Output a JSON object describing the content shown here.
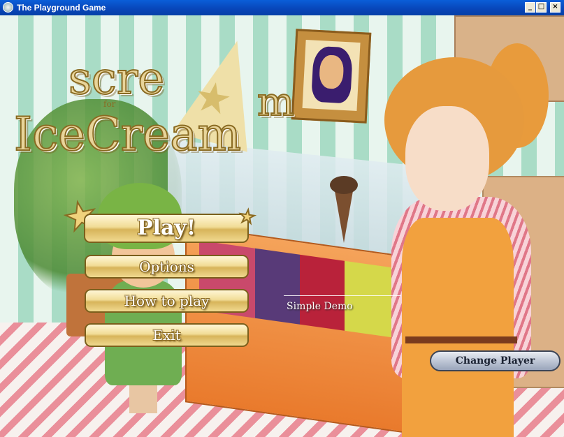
{
  "window": {
    "title": "The Playground Game",
    "controls": {
      "minimize": "_",
      "maximize": "□",
      "close": "×"
    }
  },
  "logo": {
    "line1": "scre",
    "line1_end": "m",
    "small": "for",
    "line2": "IceCream"
  },
  "menu": {
    "play": "Play!",
    "options": "Options",
    "how_to_play": "How to play",
    "exit": "Exit"
  },
  "demo_label": "Simple Demo",
  "change_player": "Change Player",
  "icons": [
    "app-icon",
    "star-icon",
    "minimize-icon",
    "maximize-icon",
    "close-icon"
  ],
  "colors": {
    "titlebar": "#0845b8",
    "button_gold": "#d7b45a",
    "button_outline": "#7b5f1c",
    "change_player_bg": "#bfc7d6"
  }
}
